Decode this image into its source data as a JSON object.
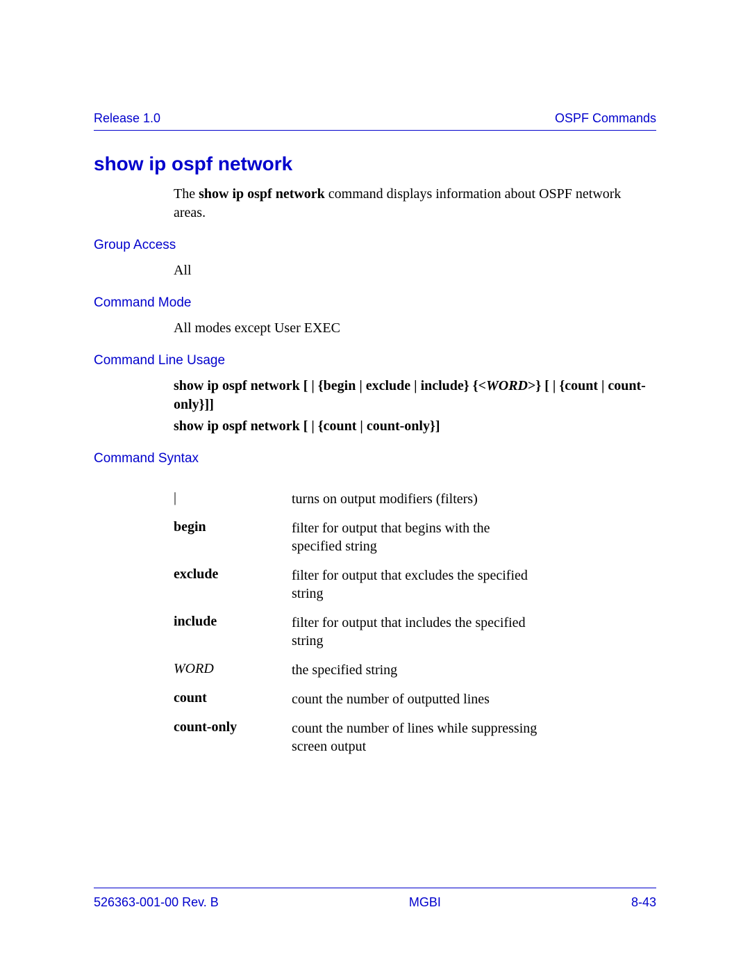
{
  "header": {
    "left": "Release 1.0",
    "right": "OSPF Commands"
  },
  "title": "show ip ospf network",
  "intro": {
    "prefix": "The ",
    "cmd": "show ip ospf network",
    "suffix": " command displays information about OSPF network areas."
  },
  "sections": {
    "group_access": {
      "label": "Group Access",
      "value": "All"
    },
    "command_mode": {
      "label": "Command Mode",
      "value": "All modes except User EXEC"
    },
    "command_line_usage": {
      "label": "Command Line Usage",
      "line1": {
        "a": "show ip ospf network  [ | {begin | exclude | include} {<",
        "word": "WORD",
        "b": ">} [ | {count | count-only}]]"
      },
      "line2": "show ip ospf network  [ | {count | count-only}]"
    },
    "command_syntax": {
      "label": "Command Syntax",
      "rows": [
        {
          "key": "|",
          "style": "",
          "desc": "turns on output modifiers (filters)"
        },
        {
          "key": "begin",
          "style": "bold",
          "desc": "filter for output that begins with the specified string"
        },
        {
          "key": "exclude",
          "style": "bold",
          "desc": "filter for output that excludes the specified string"
        },
        {
          "key": "include",
          "style": "bold",
          "desc": "filter for output that includes the specified string"
        },
        {
          "key": "WORD",
          "style": "ital",
          "desc": "the specified string"
        },
        {
          "key": "count",
          "style": "bold",
          "desc": "count the number of outputted lines"
        },
        {
          "key": "count-only",
          "style": "bold",
          "desc": "count the number of lines while suppressing screen output"
        }
      ]
    }
  },
  "footer": {
    "left": "526363-001-00 Rev. B",
    "center": "MGBI",
    "right": "8-43"
  }
}
